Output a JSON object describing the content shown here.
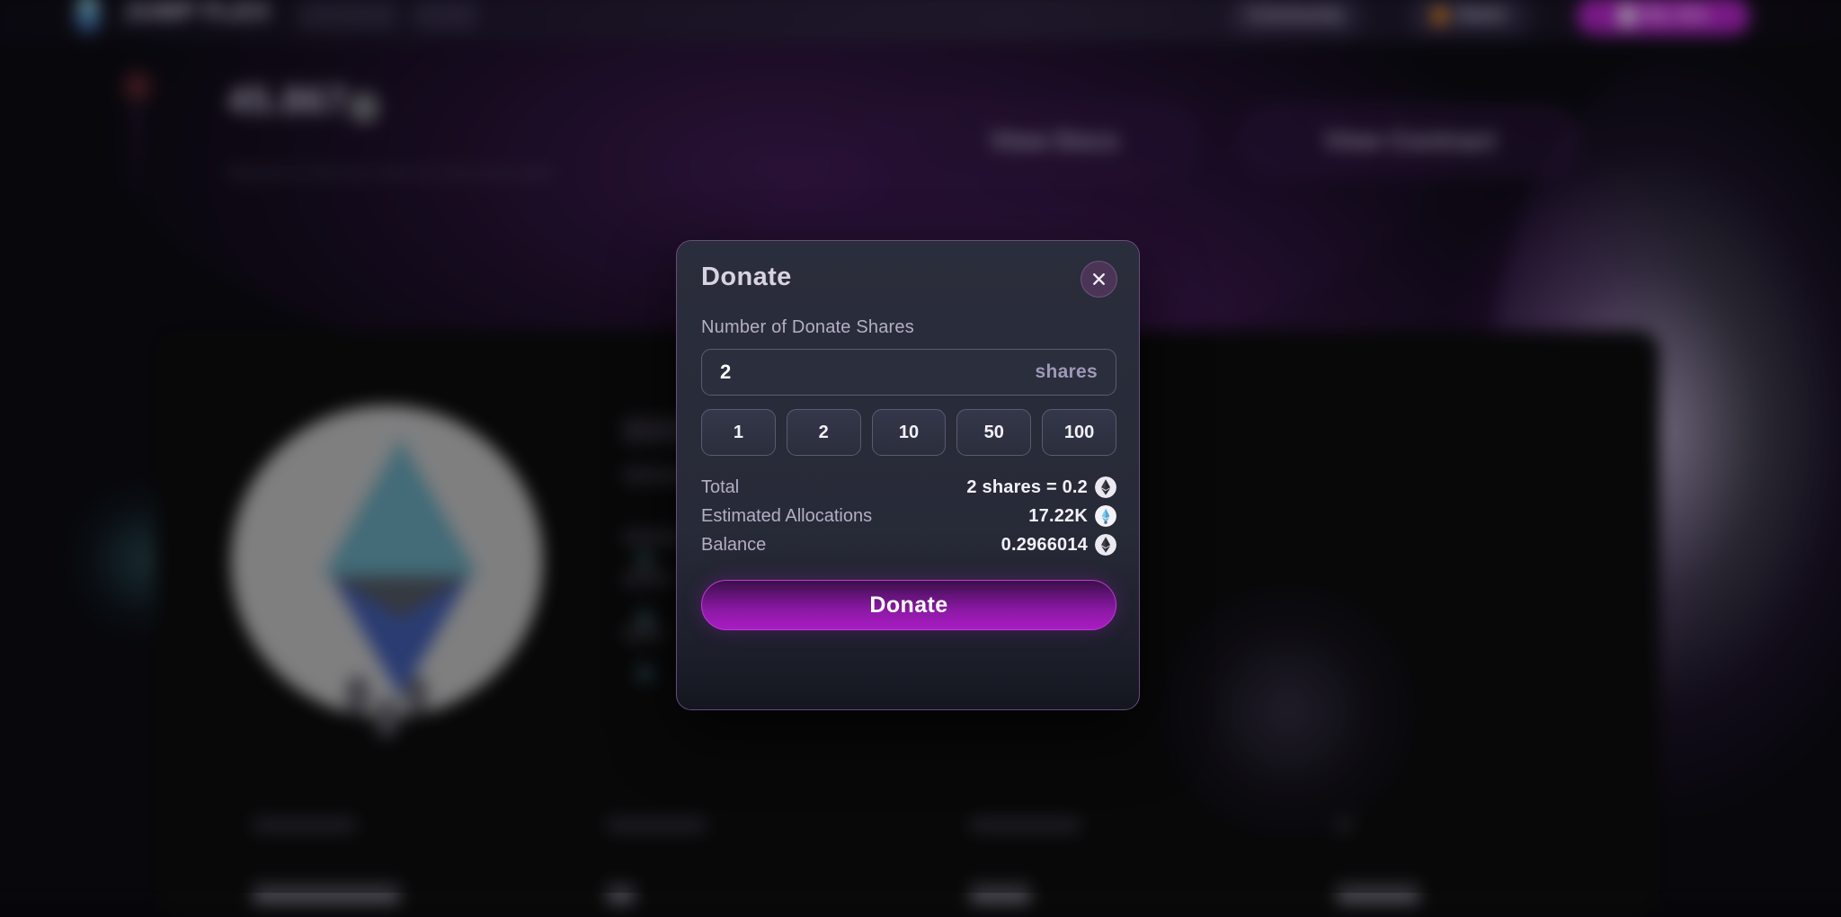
{
  "background": {
    "topbar": {
      "brand_name": "JUMP FLEX",
      "nav_pills": [
        {
          "label": "Community",
          "icon": ""
        },
        {
          "label": "Wallet",
          "icon": "wallet-icon"
        },
        {
          "label": "My Jets",
          "icon": "avatar-icon"
        }
      ]
    },
    "hero": {
      "title": "45.867",
      "subtitle": "Deposit to the pool and win the prize pool",
      "buttons": [
        "View Docs",
        "View Contract"
      ]
    }
  },
  "modal": {
    "title": "Donate",
    "close_icon": "close-icon",
    "field_label": "Number of Donate Shares",
    "input": {
      "value": "2",
      "placeholder": "0",
      "unit": "shares"
    },
    "presets": [
      "1",
      "2",
      "10",
      "50",
      "100"
    ],
    "summary": [
      {
        "label": "Total",
        "value": "2 shares = 0.2",
        "icon": "ethereum-icon"
      },
      {
        "label": "Estimated Allocations",
        "value": "17.22K",
        "icon": "gem-icon"
      },
      {
        "label": "Balance",
        "value": "0.2966014",
        "icon": "ethereum-icon"
      }
    ],
    "submit_label": "Donate",
    "colors": {
      "accent": "#a81cc2",
      "border": "#6a4b7c",
      "surface": "#2a2d3b",
      "close_bg": "#4b3557"
    }
  }
}
